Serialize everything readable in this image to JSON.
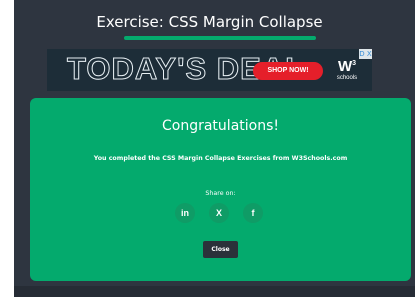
{
  "header": {
    "title": "Exercise: CSS Margin Collapse"
  },
  "ad": {
    "headline": "TODAY'S DEAL",
    "cta": "SHOP NOW!",
    "brand": "W3",
    "brand_sup": "3",
    "brand_sub": "schools",
    "badge": "D X"
  },
  "modal": {
    "title": "Congratulations!",
    "message": "You completed the CSS Margin Collapse Exercises from W3Schools.com",
    "share_label": "Share on:",
    "share_buttons": [
      {
        "label": "in",
        "icon": "linkedin-icon"
      },
      {
        "label": "X",
        "icon": "x-icon"
      },
      {
        "label": "f",
        "icon": "facebook-icon"
      }
    ],
    "close_label": "Close"
  },
  "colors": {
    "accent": "#04aa6d",
    "page_bg": "#2e3540",
    "ad_cta": "#e51f2a"
  }
}
